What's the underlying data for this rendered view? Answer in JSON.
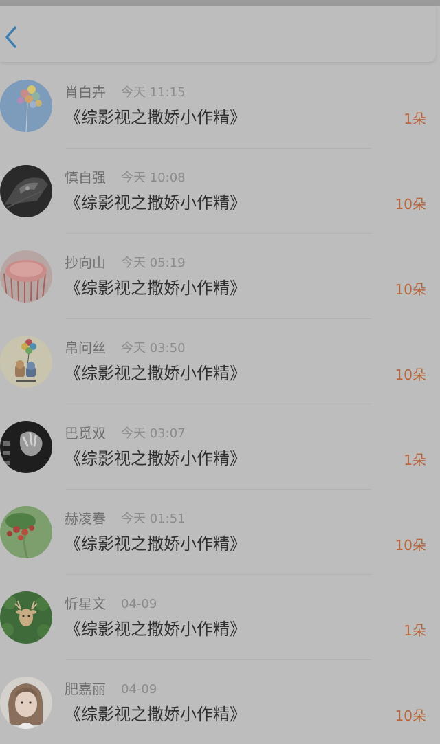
{
  "colors": {
    "background": "#bdbdbd",
    "back_icon": "#3d7fb0",
    "name_text": "#6e6e6e",
    "time_text": "#8c8c8c",
    "title_text": "#303030",
    "amount_text": "#b8653c"
  },
  "navbar": {
    "back_icon": "chevron-left-icon"
  },
  "list": {
    "items": [
      {
        "name": "肖白卉",
        "time": "今天 11:15",
        "title": "《综影视之撒娇小作精》",
        "amount": "1朵",
        "avatar": "balloons-avatar"
      },
      {
        "name": "慎自强",
        "time": "今天 10:08",
        "title": "《综影视之撒娇小作精》",
        "amount": "10朵",
        "avatar": "car-dark-avatar"
      },
      {
        "name": "抄向山",
        "time": "今天 05:19",
        "title": "《综影视之撒娇小作精》",
        "amount": "10朵",
        "avatar": "pink-dish-avatar"
      },
      {
        "name": "帛问丝",
        "time": "今天 03:50",
        "title": "《综影视之撒娇小作精》",
        "amount": "10朵",
        "avatar": "cartoon-balloons-avatar"
      },
      {
        "name": "巴觅双",
        "time": "今天 03:07",
        "title": "《综影视之撒娇小作精》",
        "amount": "1朵",
        "avatar": "hands-dark-avatar"
      },
      {
        "name": "赫凌春",
        "time": "今天 01:51",
        "title": "《综影视之撒娇小作精》",
        "amount": "10朵",
        "avatar": "strawberries-avatar"
      },
      {
        "name": "忻星文",
        "time": "04-09",
        "title": "《综影视之撒娇小作精》",
        "amount": "1朵",
        "avatar": "deer-leaves-avatar"
      },
      {
        "name": "肥嘉丽",
        "time": "04-09",
        "title": "《综影视之撒娇小作精》",
        "amount": "10朵",
        "avatar": "girl-portrait-avatar"
      }
    ]
  }
}
